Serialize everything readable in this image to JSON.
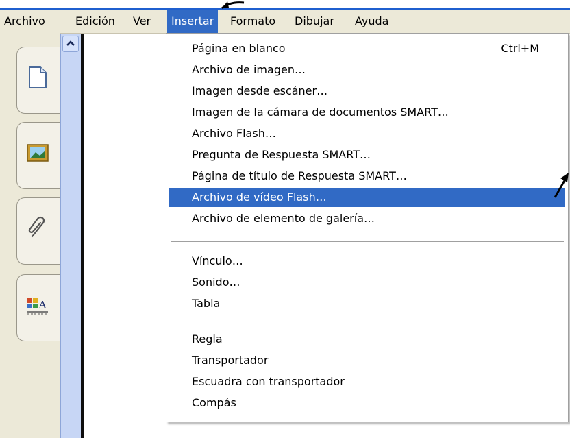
{
  "menubar": {
    "items": [
      {
        "label": "Archivo"
      },
      {
        "label": "Edición"
      },
      {
        "label": "Ver"
      },
      {
        "label": "Insertar",
        "active": true
      },
      {
        "label": "Formato"
      },
      {
        "label": "Dibujar"
      },
      {
        "label": "Ayuda"
      }
    ]
  },
  "insert_menu": {
    "groups": [
      [
        {
          "label": "Página en blanco",
          "shortcut": "Ctrl+M"
        },
        {
          "label": "Archivo de imagen…"
        },
        {
          "label": "Imagen desde escáner…"
        },
        {
          "label": "Imagen de la cámara de documentos SMART…"
        },
        {
          "label": "Archivo Flash…"
        },
        {
          "label": "Pregunta de Respuesta SMART…"
        },
        {
          "label": "Página de título de Respuesta SMART…"
        },
        {
          "label": "Archivo de vídeo Flash…",
          "highlighted": true
        },
        {
          "label": "Archivo de elemento de galería…"
        }
      ],
      [
        {
          "label": "Vínculo…"
        },
        {
          "label": "Sonido…"
        },
        {
          "label": "Tabla"
        }
      ],
      [
        {
          "label": "Regla"
        },
        {
          "label": "Transportador"
        },
        {
          "label": "Escuadra con transportador"
        },
        {
          "label": "Compás"
        }
      ]
    ]
  },
  "side_toolbar": {
    "buttons": [
      {
        "icon": "page-sorter-icon"
      },
      {
        "icon": "gallery-icon"
      },
      {
        "icon": "attachments-icon"
      },
      {
        "icon": "properties-icon"
      }
    ]
  },
  "colors": {
    "menu_highlight": "#316ac5",
    "menubar_bg": "#ece9d8",
    "accent_line": "#1f5fcf"
  }
}
